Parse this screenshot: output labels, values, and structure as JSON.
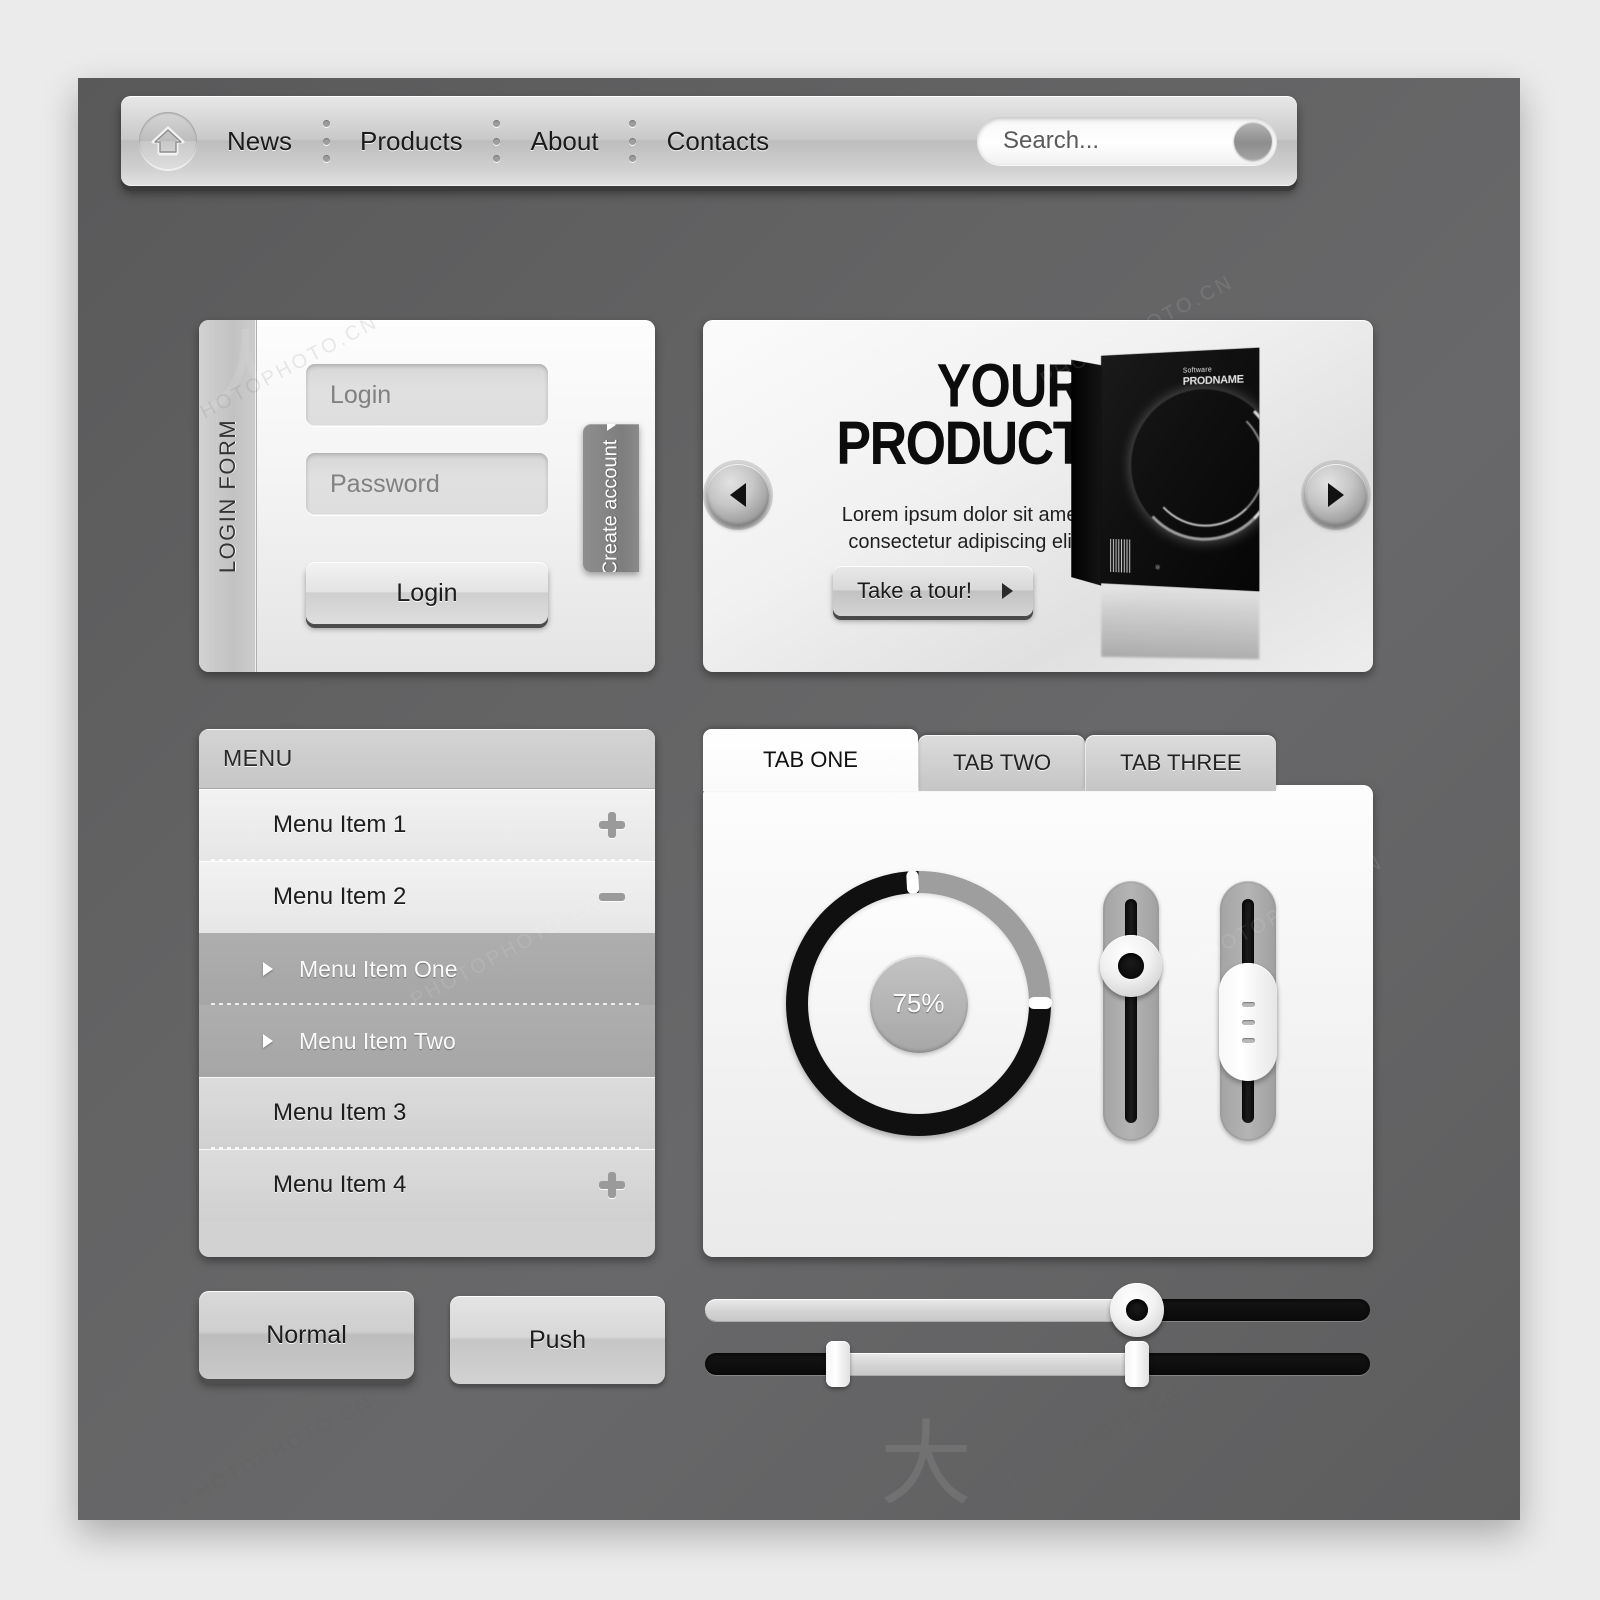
{
  "nav": {
    "home_icon": "home-icon",
    "links": [
      "News",
      "Products",
      "About",
      "Contacts"
    ],
    "search_placeholder": "Search...",
    "search_value": "Search..."
  },
  "login_form": {
    "side_title": "LOGIN FORM",
    "login_placeholder": "Login",
    "password_placeholder": "Password",
    "submit_label": "Login",
    "create_account_label": "Create account"
  },
  "banner": {
    "title_line1": "YOUR",
    "title_line2": "PRODUCT",
    "subtitle": "Lorem ipsum dolor sit amet consectetur adipiscing elit!",
    "cta_label": "Take a tour!",
    "prev_icon": "chevron-left-icon",
    "next_icon": "chevron-right-icon",
    "box_brand_small": "Software",
    "box_brand_big": "PRODNAME",
    "box_logo": "logo"
  },
  "menu": {
    "header": "MENU",
    "items": [
      {
        "label": "Menu Item 1",
        "level": 1,
        "toggle": "plus"
      },
      {
        "label": "Menu Item 2",
        "level": 1,
        "toggle": "minus"
      },
      {
        "label": "Menu Item One",
        "level": 2,
        "toggle": "none"
      },
      {
        "label": "Menu Item Two",
        "level": 2,
        "toggle": "none"
      },
      {
        "label": "Menu Item 3",
        "level": 1,
        "toggle": "none"
      },
      {
        "label": "Menu Item 4",
        "level": 1,
        "toggle": "plus"
      }
    ]
  },
  "tabs": {
    "items": [
      "TAB ONE",
      "TAB TWO",
      "TAB THREE"
    ],
    "active_index": 0
  },
  "controls": {
    "circular_progress_label": "75%",
    "circular_progress_value": 75,
    "vertical_slider_1_value": 30,
    "vertical_slider_2_value": 55,
    "horizontal_slider_1_value": 65,
    "horizontal_range_low": 20,
    "horizontal_range_high": 65
  },
  "buttons": {
    "normal_label": "Normal",
    "push_label": "Push"
  },
  "colors": {
    "canvas_bg": "#636364",
    "page_bg": "#ebebeb",
    "panel_light": "#f4f4f4",
    "accent_dark": "#101010",
    "track_gray": "#9e9e9e"
  },
  "watermark": {
    "text": "PHOTOPHOTO.CN"
  }
}
